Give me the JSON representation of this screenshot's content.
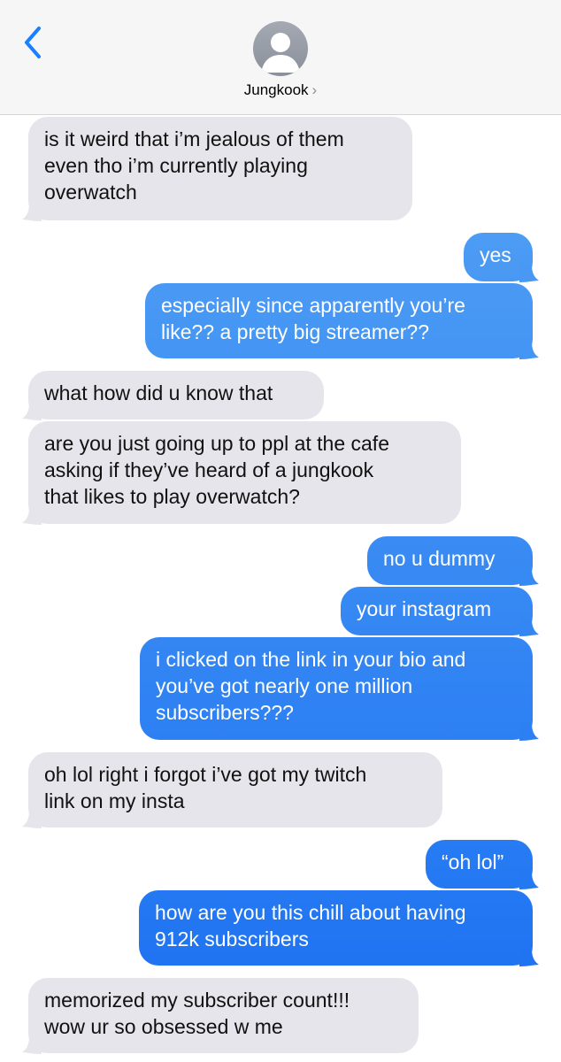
{
  "header": {
    "contact_name": "Jungkook",
    "chevron": "›",
    "back_icon": "chevron-left-icon",
    "avatar_icon": "person-silhouette-icon",
    "accent": "#1a80ff"
  },
  "messages": [
    {
      "side": "in",
      "text": "is it weird that i’m jealous of them\neven tho i’m currently playing\noverwatch"
    },
    {
      "side": "out",
      "text": "yes"
    },
    {
      "side": "out",
      "text": "especially since apparently you’re\nlike?? a pretty big streamer??"
    },
    {
      "side": "in",
      "text": "what how did u know that"
    },
    {
      "side": "in",
      "text": "are you just going up to ppl at the cafe\nasking if they’ve heard of a jungkook\nthat likes to play overwatch?"
    },
    {
      "side": "out",
      "text": "no u dummy"
    },
    {
      "side": "out",
      "text": "your instagram"
    },
    {
      "side": "out",
      "text": "i clicked on the link in your bio and\nyou’ve got nearly one million\nsubscribers???"
    },
    {
      "side": "in",
      "text": "oh lol right i forgot i’ve got my twitch\nlink on my insta"
    },
    {
      "side": "out",
      "text": "“oh lol”"
    },
    {
      "side": "out",
      "text": "how are you this chill about having\n912k subscribers"
    },
    {
      "side": "in",
      "text": "memorized my subscriber count!!!\nwow ur so obsessed w me"
    }
  ],
  "colors": {
    "incoming_bubble": "#e6e5eb",
    "outgoing_top": "#5aa8f5",
    "outgoing_bottom": "#1a6ff2"
  }
}
